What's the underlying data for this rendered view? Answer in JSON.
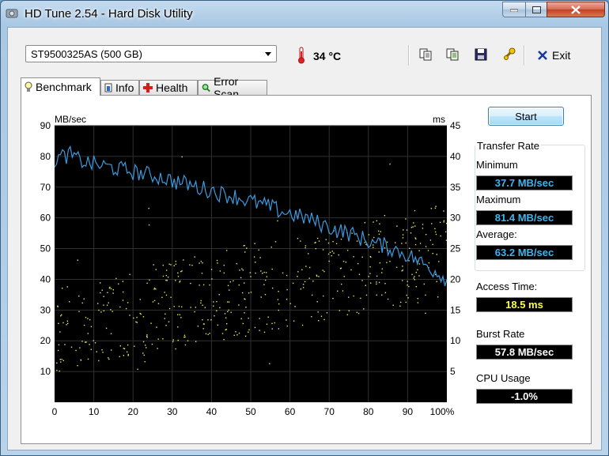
{
  "window": {
    "title": "HD Tune 2.54 - Hard Disk Utility"
  },
  "toolbar": {
    "drive": "ST9500325AS (500 GB)",
    "temperature": "34 °C",
    "exit_label": "Exit",
    "icons": [
      "copy-icon",
      "copy-text-icon",
      "save-icon",
      "options-icon",
      "exit-icon"
    ]
  },
  "tabs": [
    {
      "label": "Benchmark",
      "icon": "bulb-icon",
      "active": true
    },
    {
      "label": "Info",
      "icon": "info-icon",
      "active": false
    },
    {
      "label": "Health",
      "icon": "health-cross-icon",
      "active": false
    },
    {
      "label": "Error Scan",
      "icon": "magnifier-icon",
      "active": false
    }
  ],
  "benchmark": {
    "start_label": "Start",
    "transfer_rate_title": "Transfer Rate",
    "minimum_label": "Minimum",
    "minimum_value": "37.7 MB/sec",
    "maximum_label": "Maximum",
    "maximum_value": "81.4 MB/sec",
    "average_label": "Average:",
    "average_value": "63.2 MB/sec",
    "access_time_label": "Access Time:",
    "access_time_value": "18.5 ms",
    "burst_rate_label": "Burst Rate",
    "burst_rate_value": "57.8 MB/sec",
    "cpu_usage_label": "CPU Usage",
    "cpu_usage_value": "-1.0%"
  },
  "colors": {
    "transfer_line": "#3a9be0",
    "access_dots": "#e8e85a",
    "value_cyan": "#3fb4ef",
    "value_yellow": "#ffff3c"
  },
  "chart_data": {
    "type": "line",
    "ylabel": "MB/sec",
    "y2label": "ms",
    "ylim": [
      0,
      90
    ],
    "y2lim": [
      0,
      45
    ],
    "xlim": [
      0,
      100
    ],
    "x_ticks": [
      "0",
      "10",
      "20",
      "30",
      "40",
      "50",
      "60",
      "70",
      "80",
      "90",
      "100%"
    ],
    "y_ticks": [
      "10",
      "20",
      "30",
      "40",
      "50",
      "60",
      "70",
      "80",
      "90"
    ],
    "y2_ticks": [
      "5",
      "10",
      "15",
      "20",
      "25",
      "30",
      "35",
      "40",
      "45"
    ],
    "series": [
      {
        "type": "line",
        "x": [
          0,
          2,
          4,
          6,
          8,
          10,
          12,
          14,
          16,
          18,
          20,
          22,
          24,
          26,
          28,
          30,
          32,
          34,
          36,
          38,
          40,
          42,
          44,
          46,
          48,
          50,
          52,
          54,
          56,
          58,
          60,
          62,
          64,
          66,
          68,
          70,
          72,
          74,
          76,
          78,
          80,
          82,
          84,
          86,
          88,
          90,
          92,
          94,
          96,
          98,
          100
        ],
        "values": [
          79,
          80,
          80.5,
          79,
          78,
          77.5,
          77,
          76.5,
          76,
          75.5,
          75,
          74.5,
          74,
          73.5,
          73,
          72,
          71.5,
          71,
          70,
          69.5,
          69,
          68,
          67.5,
          67,
          66,
          65.5,
          64.5,
          64,
          63,
          62,
          61.5,
          60.5,
          60,
          59,
          58,
          57,
          56,
          55.5,
          54.5,
          53.5,
          52.5,
          51.5,
          51,
          50,
          49,
          48,
          46.5,
          45,
          43.5,
          42,
          40
        ]
      },
      {
        "type": "scatter",
        "description_unit": "ms",
        "x_range": [
          0,
          100
        ],
        "band_low_start": 5,
        "band_high_start": 19,
        "band_low_end": 17,
        "band_high_end": 33
      }
    ]
  }
}
